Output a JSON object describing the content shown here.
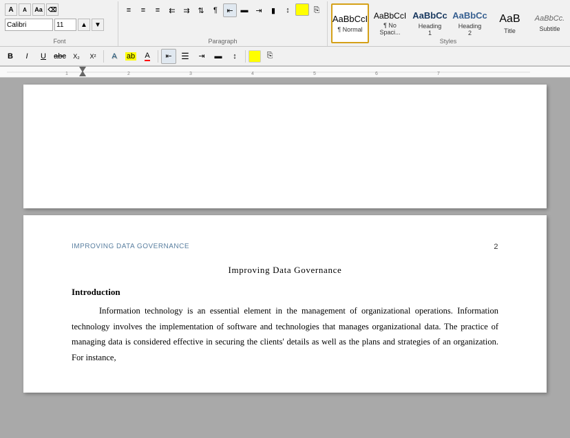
{
  "ribbon": {
    "font_name": "Calibri",
    "font_size": "11",
    "styles": [
      {
        "id": "normal",
        "preview": "AaBbCcI",
        "label": "¶ Normal",
        "active": true,
        "class": "style-normal"
      },
      {
        "id": "nospace",
        "preview": "AaBbCcI",
        "label": "¶ No Spaci...",
        "active": false,
        "class": "style-nospace"
      },
      {
        "id": "heading1",
        "preview": "AaBbCc",
        "label": "Heading 1",
        "active": false,
        "class": "style-h1"
      },
      {
        "id": "heading2",
        "preview": "AaBbCc",
        "label": "Heading 2",
        "active": false,
        "class": "style-h2"
      },
      {
        "id": "title",
        "preview": "AaB",
        "label": "Title",
        "active": false,
        "class": "style-title"
      },
      {
        "id": "subtitle",
        "preview": "AaBbCc.",
        "label": "Subtitle",
        "active": false,
        "class": "style-subtitle"
      }
    ],
    "para_label": "Paragraph",
    "styles_label": "Styles"
  },
  "ruler": {
    "marks": [
      "1",
      "2",
      "3",
      "4",
      "5",
      "6",
      "7"
    ]
  },
  "pages": [
    {
      "id": "page1",
      "blank": true
    },
    {
      "id": "page2",
      "header": "IMPROVING DATA GOVERNANCE",
      "page_number": "2",
      "title": "Improving Data Governance",
      "heading": "Introduction",
      "paragraph": "Information technology is an essential  element in the management  of organizational operations.  Information technology involves  the implementation  of software and technologies that manages  organizational  data.  The practice of managing  data is considered effective in securing the clients'  details as well as the plans and strategies of an organization.  For instance,"
    }
  ]
}
